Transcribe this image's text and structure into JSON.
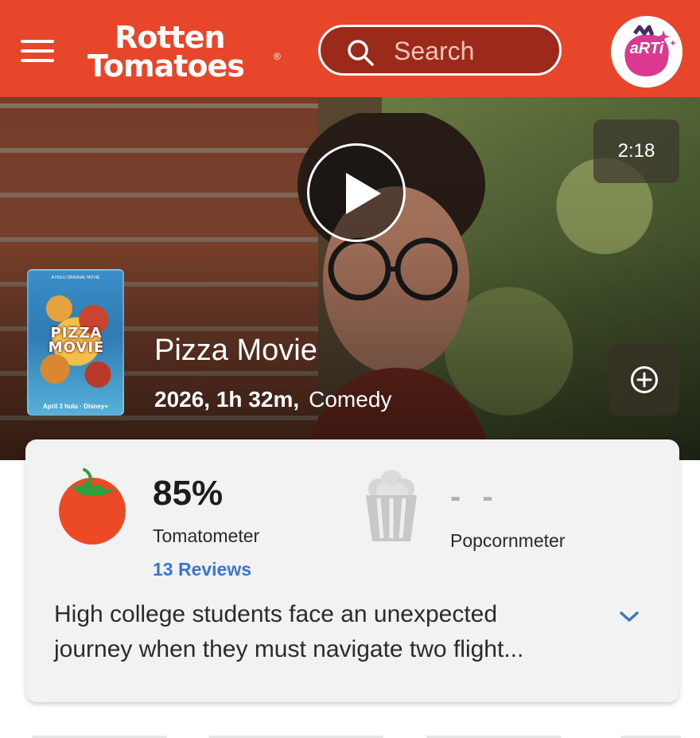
{
  "header": {
    "brand_line1": "Rotten",
    "brand_line2": "Tomatoes",
    "brand_mark": "®",
    "search_placeholder": "Search",
    "avatar_text": "aRTi",
    "colors": {
      "brand": "#e8462b",
      "search_bg": "#9b2a1a"
    }
  },
  "hero": {
    "duration": "2:18",
    "title": "Pizza Movie",
    "meta_year_runtime": "2026, 1h 32m,",
    "genre": "Comedy",
    "poster": {
      "title": "PIZZA MOVIE",
      "top_text": "A HULU ORIGINAL MOVIE",
      "bottom_text": "April 3 hulu · Disney+"
    }
  },
  "scores": {
    "tomatometer": {
      "value": "85%",
      "label": "Tomatometer",
      "reviews": "13 Reviews"
    },
    "popcornmeter": {
      "value": "- -",
      "label": "Popcornmeter"
    }
  },
  "synopsis": {
    "line1": "High college students face an unexpected",
    "line2": "journey when they must navigate two flight..."
  },
  "icons": {
    "menu": "menu-icon",
    "search": "search-icon",
    "play": "play-icon",
    "add": "plus-circle-icon",
    "tomato": "tomato-icon",
    "popcorn": "popcorn-bucket-icon",
    "expand": "chevron-down-icon"
  }
}
